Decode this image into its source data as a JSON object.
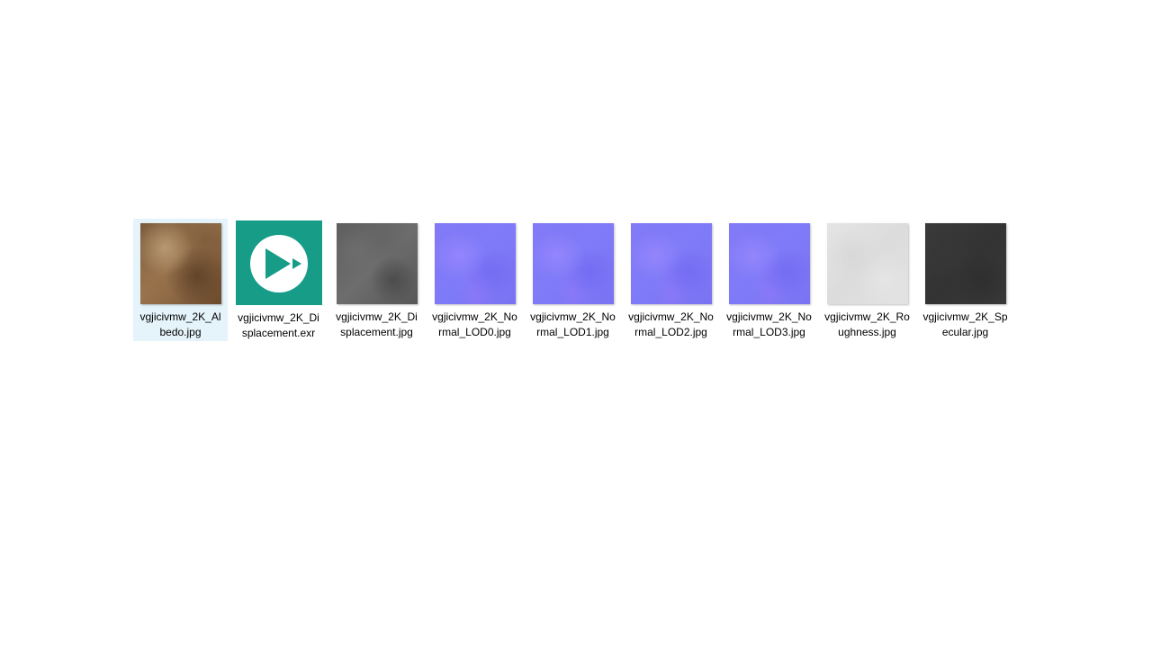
{
  "files": [
    {
      "name": "vgjicivmw_2K_Albedo.jpg",
      "thumbnail": "albedo-texture",
      "selected": true
    },
    {
      "name": "vgjicivmw_2K_Displacement.exr",
      "thumbnail": "exr-file-icon",
      "selected": false
    },
    {
      "name": "vgjicivmw_2K_Displacement.jpg",
      "thumbnail": "displacement-texture",
      "selected": false
    },
    {
      "name": "vgjicivmw_2K_Normal_LOD0.jpg",
      "thumbnail": "normal-map-texture",
      "selected": false
    },
    {
      "name": "vgjicivmw_2K_Normal_LOD1.jpg",
      "thumbnail": "normal-map-texture",
      "selected": false
    },
    {
      "name": "vgjicivmw_2K_Normal_LOD2.jpg",
      "thumbnail": "normal-map-texture",
      "selected": false
    },
    {
      "name": "vgjicivmw_2K_Normal_LOD3.jpg",
      "thumbnail": "normal-map-texture",
      "selected": false
    },
    {
      "name": "vgjicivmw_2K_Roughness.jpg",
      "thumbnail": "roughness-texture",
      "selected": false
    },
    {
      "name": "vgjicivmw_2K_Specular.jpg",
      "thumbnail": "specular-texture",
      "selected": false
    }
  ],
  "colors": {
    "selection_bg": "#e5f3fb",
    "exr_icon_bg": "#169c87",
    "normal_map": "#7f7bf8"
  }
}
